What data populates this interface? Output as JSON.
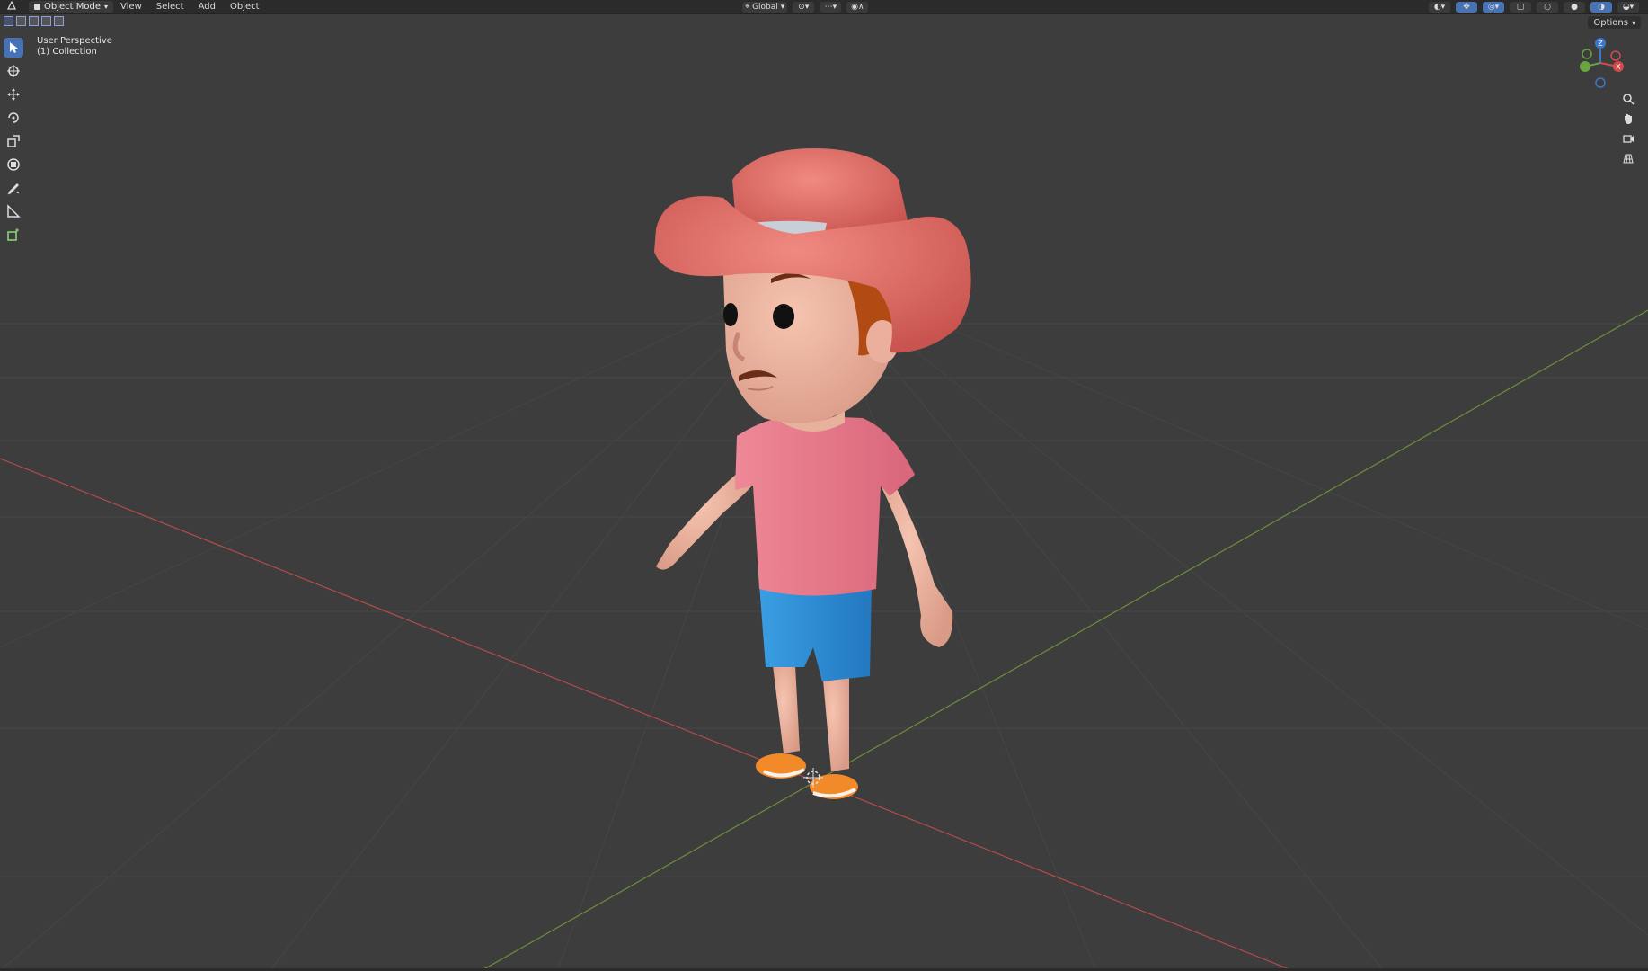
{
  "header": {
    "mode_label": "Object Mode",
    "menus": [
      "View",
      "Select",
      "Add",
      "Object"
    ],
    "transform_orientation": "Global"
  },
  "viewport": {
    "perspective_label": "User Perspective",
    "collection_label": "(1) Collection"
  },
  "options_label": "Options",
  "gizmo": {
    "z_label": "Z",
    "x_label": "X",
    "y_label": "Y"
  },
  "toolbar_icons": [
    "select-box-icon",
    "cursor-icon",
    "move-icon",
    "rotate-icon",
    "scale-icon",
    "transform-icon",
    "annotate-icon",
    "measure-icon",
    "add-cube-icon"
  ],
  "colors": {
    "viewport_bg": "#3d3d3d",
    "x_axis": "#b54b4b",
    "y_axis": "#6d8f3a",
    "accent": "#4772b3",
    "hat": "#e36f66",
    "shirt": "#e57986",
    "shorts": "#2e8fd6",
    "shoes": "#f28a2a"
  }
}
